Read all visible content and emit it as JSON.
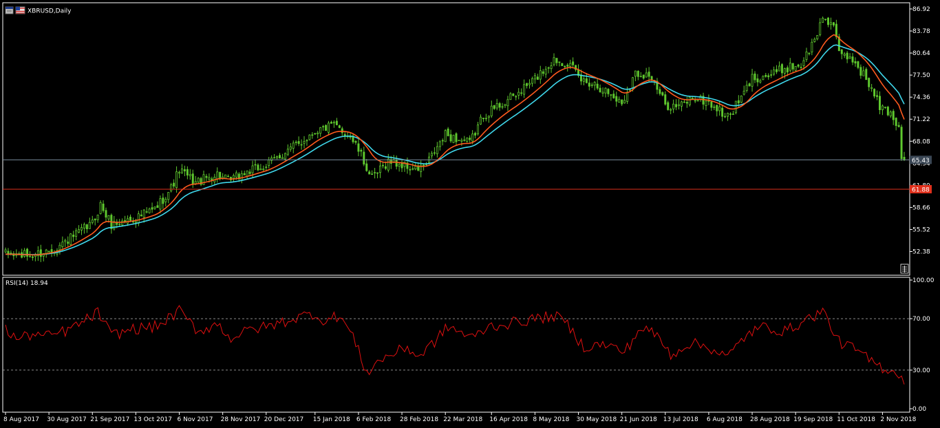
{
  "window": {
    "symbol_title": "XBRUSD,Daily",
    "rsi_title": "RSI(14) 18.94"
  },
  "colors": {
    "background": "#000000",
    "frame": "#ffffff",
    "candle": "#5fc82e",
    "ma_fast": "#ff5a1e",
    "ma_slow": "#3fd8ec",
    "rsi_line": "#e01010",
    "current_price_line": "#7a8d9e",
    "level_line": "#e0301c",
    "level_label_bg": "#e0301c",
    "current_label_bg": "#3a4654",
    "levels_dash": "#b8b8b8"
  },
  "chart_data": [
    {
      "type": "candlestick",
      "name": "price_panel",
      "symbol": "XBRUSD",
      "timeframe": "Daily",
      "ylim": [
        49.0,
        87.8
      ],
      "y_ticks": [
        "86.92",
        "83.78",
        "80.64",
        "77.50",
        "74.36",
        "71.22",
        "68.08",
        "64.94",
        "61.80",
        "58.66",
        "55.52",
        "52.38"
      ],
      "current_price": 65.43,
      "current_price_label": "65.43",
      "horizontal_level": 61.25,
      "horizontal_level_label": "61.88",
      "x_labels": [
        "8 Aug 2017",
        "30 Aug 2017",
        "21 Sep 2017",
        "13 Oct 2017",
        "6 Nov 2017",
        "28 Nov 2017",
        "20 Dec 2017",
        "15 Jan 2018",
        "6 Feb 2018",
        "28 Feb 2018",
        "22 Mar 2018",
        "16 Apr 2018",
        "8 May 2018",
        "30 May 2018",
        "21 Jun 2018",
        "13 Jul 2018",
        "6 Aug 2018",
        "28 Aug 2018",
        "19 Sep 2018",
        "11 Oct 2018",
        "2 Nov 2018"
      ],
      "close_anchors": [
        {
          "date": "2017-08-08",
          "close": 52.0
        },
        {
          "date": "2017-08-22",
          "close": 51.8
        },
        {
          "date": "2017-09-01",
          "close": 52.8
        },
        {
          "date": "2017-09-12",
          "close": 54.5
        },
        {
          "date": "2017-09-21",
          "close": 56.4
        },
        {
          "date": "2017-09-26",
          "close": 59.0
        },
        {
          "date": "2017-10-02",
          "close": 56.2
        },
        {
          "date": "2017-10-13",
          "close": 57.2
        },
        {
          "date": "2017-10-24",
          "close": 58.4
        },
        {
          "date": "2017-11-01",
          "close": 61.4
        },
        {
          "date": "2017-11-06",
          "close": 64.0
        },
        {
          "date": "2017-11-14",
          "close": 62.2
        },
        {
          "date": "2017-11-24",
          "close": 63.4
        },
        {
          "date": "2017-11-30",
          "close": 62.4
        },
        {
          "date": "2017-12-11",
          "close": 63.7
        },
        {
          "date": "2017-12-20",
          "close": 64.6
        },
        {
          "date": "2017-12-28",
          "close": 66.3
        },
        {
          "date": "2018-01-08",
          "close": 68.0
        },
        {
          "date": "2018-01-15",
          "close": 69.6
        },
        {
          "date": "2018-01-24",
          "close": 70.3
        },
        {
          "date": "2018-02-01",
          "close": 68.8
        },
        {
          "date": "2018-02-06",
          "close": 66.8
        },
        {
          "date": "2018-02-13",
          "close": 62.7
        },
        {
          "date": "2018-02-21",
          "close": 65.3
        },
        {
          "date": "2018-02-28",
          "close": 64.7
        },
        {
          "date": "2018-03-07",
          "close": 64.0
        },
        {
          "date": "2018-03-13",
          "close": 64.7
        },
        {
          "date": "2018-03-22",
          "close": 69.0
        },
        {
          "date": "2018-04-04",
          "close": 67.8
        },
        {
          "date": "2018-04-11",
          "close": 71.8
        },
        {
          "date": "2018-04-20",
          "close": 73.5
        },
        {
          "date": "2018-04-27",
          "close": 74.6
        },
        {
          "date": "2018-05-08",
          "close": 77.0
        },
        {
          "date": "2018-05-17",
          "close": 79.7
        },
        {
          "date": "2018-05-24",
          "close": 79.3
        },
        {
          "date": "2018-05-31",
          "close": 76.8
        },
        {
          "date": "2018-06-07",
          "close": 76.3
        },
        {
          "date": "2018-06-14",
          "close": 75.0
        },
        {
          "date": "2018-06-21",
          "close": 73.5
        },
        {
          "date": "2018-06-28",
          "close": 77.8
        },
        {
          "date": "2018-07-05",
          "close": 77.6
        },
        {
          "date": "2018-07-13",
          "close": 73.3
        },
        {
          "date": "2018-07-20",
          "close": 73.0
        },
        {
          "date": "2018-07-27",
          "close": 74.3
        },
        {
          "date": "2018-08-06",
          "close": 73.6
        },
        {
          "date": "2018-08-15",
          "close": 71.5
        },
        {
          "date": "2018-08-22",
          "close": 74.2
        },
        {
          "date": "2018-08-28",
          "close": 77.1
        },
        {
          "date": "2018-09-06",
          "close": 77.5
        },
        {
          "date": "2018-09-13",
          "close": 78.5
        },
        {
          "date": "2018-09-21",
          "close": 79.0
        },
        {
          "date": "2018-09-28",
          "close": 82.4
        },
        {
          "date": "2018-10-03",
          "close": 85.8
        },
        {
          "date": "2018-10-09",
          "close": 84.7
        },
        {
          "date": "2018-10-11",
          "close": 80.3
        },
        {
          "date": "2018-10-18",
          "close": 79.8
        },
        {
          "date": "2018-10-25",
          "close": 77.0
        },
        {
          "date": "2018-11-01",
          "close": 73.0
        },
        {
          "date": "2018-11-07",
          "close": 72.1
        },
        {
          "date": "2018-11-12",
          "close": 70.1
        },
        {
          "date": "2018-11-13",
          "close": 65.6
        },
        {
          "date": "2018-11-14",
          "close": 65.43
        }
      ],
      "series": [
        {
          "kind": "moving_average",
          "role": "fast",
          "period_hint": "short"
        },
        {
          "kind": "moving_average",
          "role": "slow",
          "period_hint": "long"
        }
      ]
    },
    {
      "type": "line",
      "name": "rsi_panel",
      "indicator": "RSI(14)",
      "current_value": 18.94,
      "ylim": [
        0,
        100
      ],
      "y_ticks": [
        "100.00",
        "70.00",
        "30.00",
        "0.00"
      ],
      "levels": [
        70,
        30
      ],
      "rsi_anchors": [
        {
          "date": "2017-08-08",
          "value": 62
        },
        {
          "date": "2017-08-14",
          "value": 54
        },
        {
          "date": "2017-08-22",
          "value": 58
        },
        {
          "date": "2017-08-29",
          "value": 56
        },
        {
          "date": "2017-09-08",
          "value": 61
        },
        {
          "date": "2017-09-18",
          "value": 68
        },
        {
          "date": "2017-09-25",
          "value": 75
        },
        {
          "date": "2017-10-02",
          "value": 57
        },
        {
          "date": "2017-10-12",
          "value": 62
        },
        {
          "date": "2017-10-25",
          "value": 64
        },
        {
          "date": "2017-11-06",
          "value": 76
        },
        {
          "date": "2017-11-15",
          "value": 60
        },
        {
          "date": "2017-11-24",
          "value": 66
        },
        {
          "date": "2017-12-01",
          "value": 55
        },
        {
          "date": "2017-12-13",
          "value": 62
        },
        {
          "date": "2017-12-21",
          "value": 64
        },
        {
          "date": "2018-01-03",
          "value": 70
        },
        {
          "date": "2018-01-12",
          "value": 74
        },
        {
          "date": "2018-01-19",
          "value": 68
        },
        {
          "date": "2018-01-26",
          "value": 73
        },
        {
          "date": "2018-02-02",
          "value": 56
        },
        {
          "date": "2018-02-09",
          "value": 28
        },
        {
          "date": "2018-02-16",
          "value": 38
        },
        {
          "date": "2018-02-26",
          "value": 44
        },
        {
          "date": "2018-03-02",
          "value": 48
        },
        {
          "date": "2018-03-08",
          "value": 40
        },
        {
          "date": "2018-03-16",
          "value": 52
        },
        {
          "date": "2018-03-23",
          "value": 64
        },
        {
          "date": "2018-04-05",
          "value": 55
        },
        {
          "date": "2018-04-13",
          "value": 64
        },
        {
          "date": "2018-04-24",
          "value": 66
        },
        {
          "date": "2018-05-08",
          "value": 70
        },
        {
          "date": "2018-05-17",
          "value": 72
        },
        {
          "date": "2018-05-23",
          "value": 68
        },
        {
          "date": "2018-06-01",
          "value": 48
        },
        {
          "date": "2018-06-13",
          "value": 50
        },
        {
          "date": "2018-06-22",
          "value": 44
        },
        {
          "date": "2018-07-02",
          "value": 63
        },
        {
          "date": "2018-07-10",
          "value": 57
        },
        {
          "date": "2018-07-17",
          "value": 42
        },
        {
          "date": "2018-07-26",
          "value": 51
        },
        {
          "date": "2018-08-06",
          "value": 48
        },
        {
          "date": "2018-08-15",
          "value": 40
        },
        {
          "date": "2018-08-24",
          "value": 58
        },
        {
          "date": "2018-09-04",
          "value": 64
        },
        {
          "date": "2018-09-13",
          "value": 60
        },
        {
          "date": "2018-09-24",
          "value": 68
        },
        {
          "date": "2018-10-03",
          "value": 76
        },
        {
          "date": "2018-10-11",
          "value": 52
        },
        {
          "date": "2018-10-19",
          "value": 46
        },
        {
          "date": "2018-10-26",
          "value": 38
        },
        {
          "date": "2018-11-02",
          "value": 32
        },
        {
          "date": "2018-11-09",
          "value": 29
        },
        {
          "date": "2018-11-13",
          "value": 23
        },
        {
          "date": "2018-11-14",
          "value": 18.94
        }
      ]
    }
  ]
}
